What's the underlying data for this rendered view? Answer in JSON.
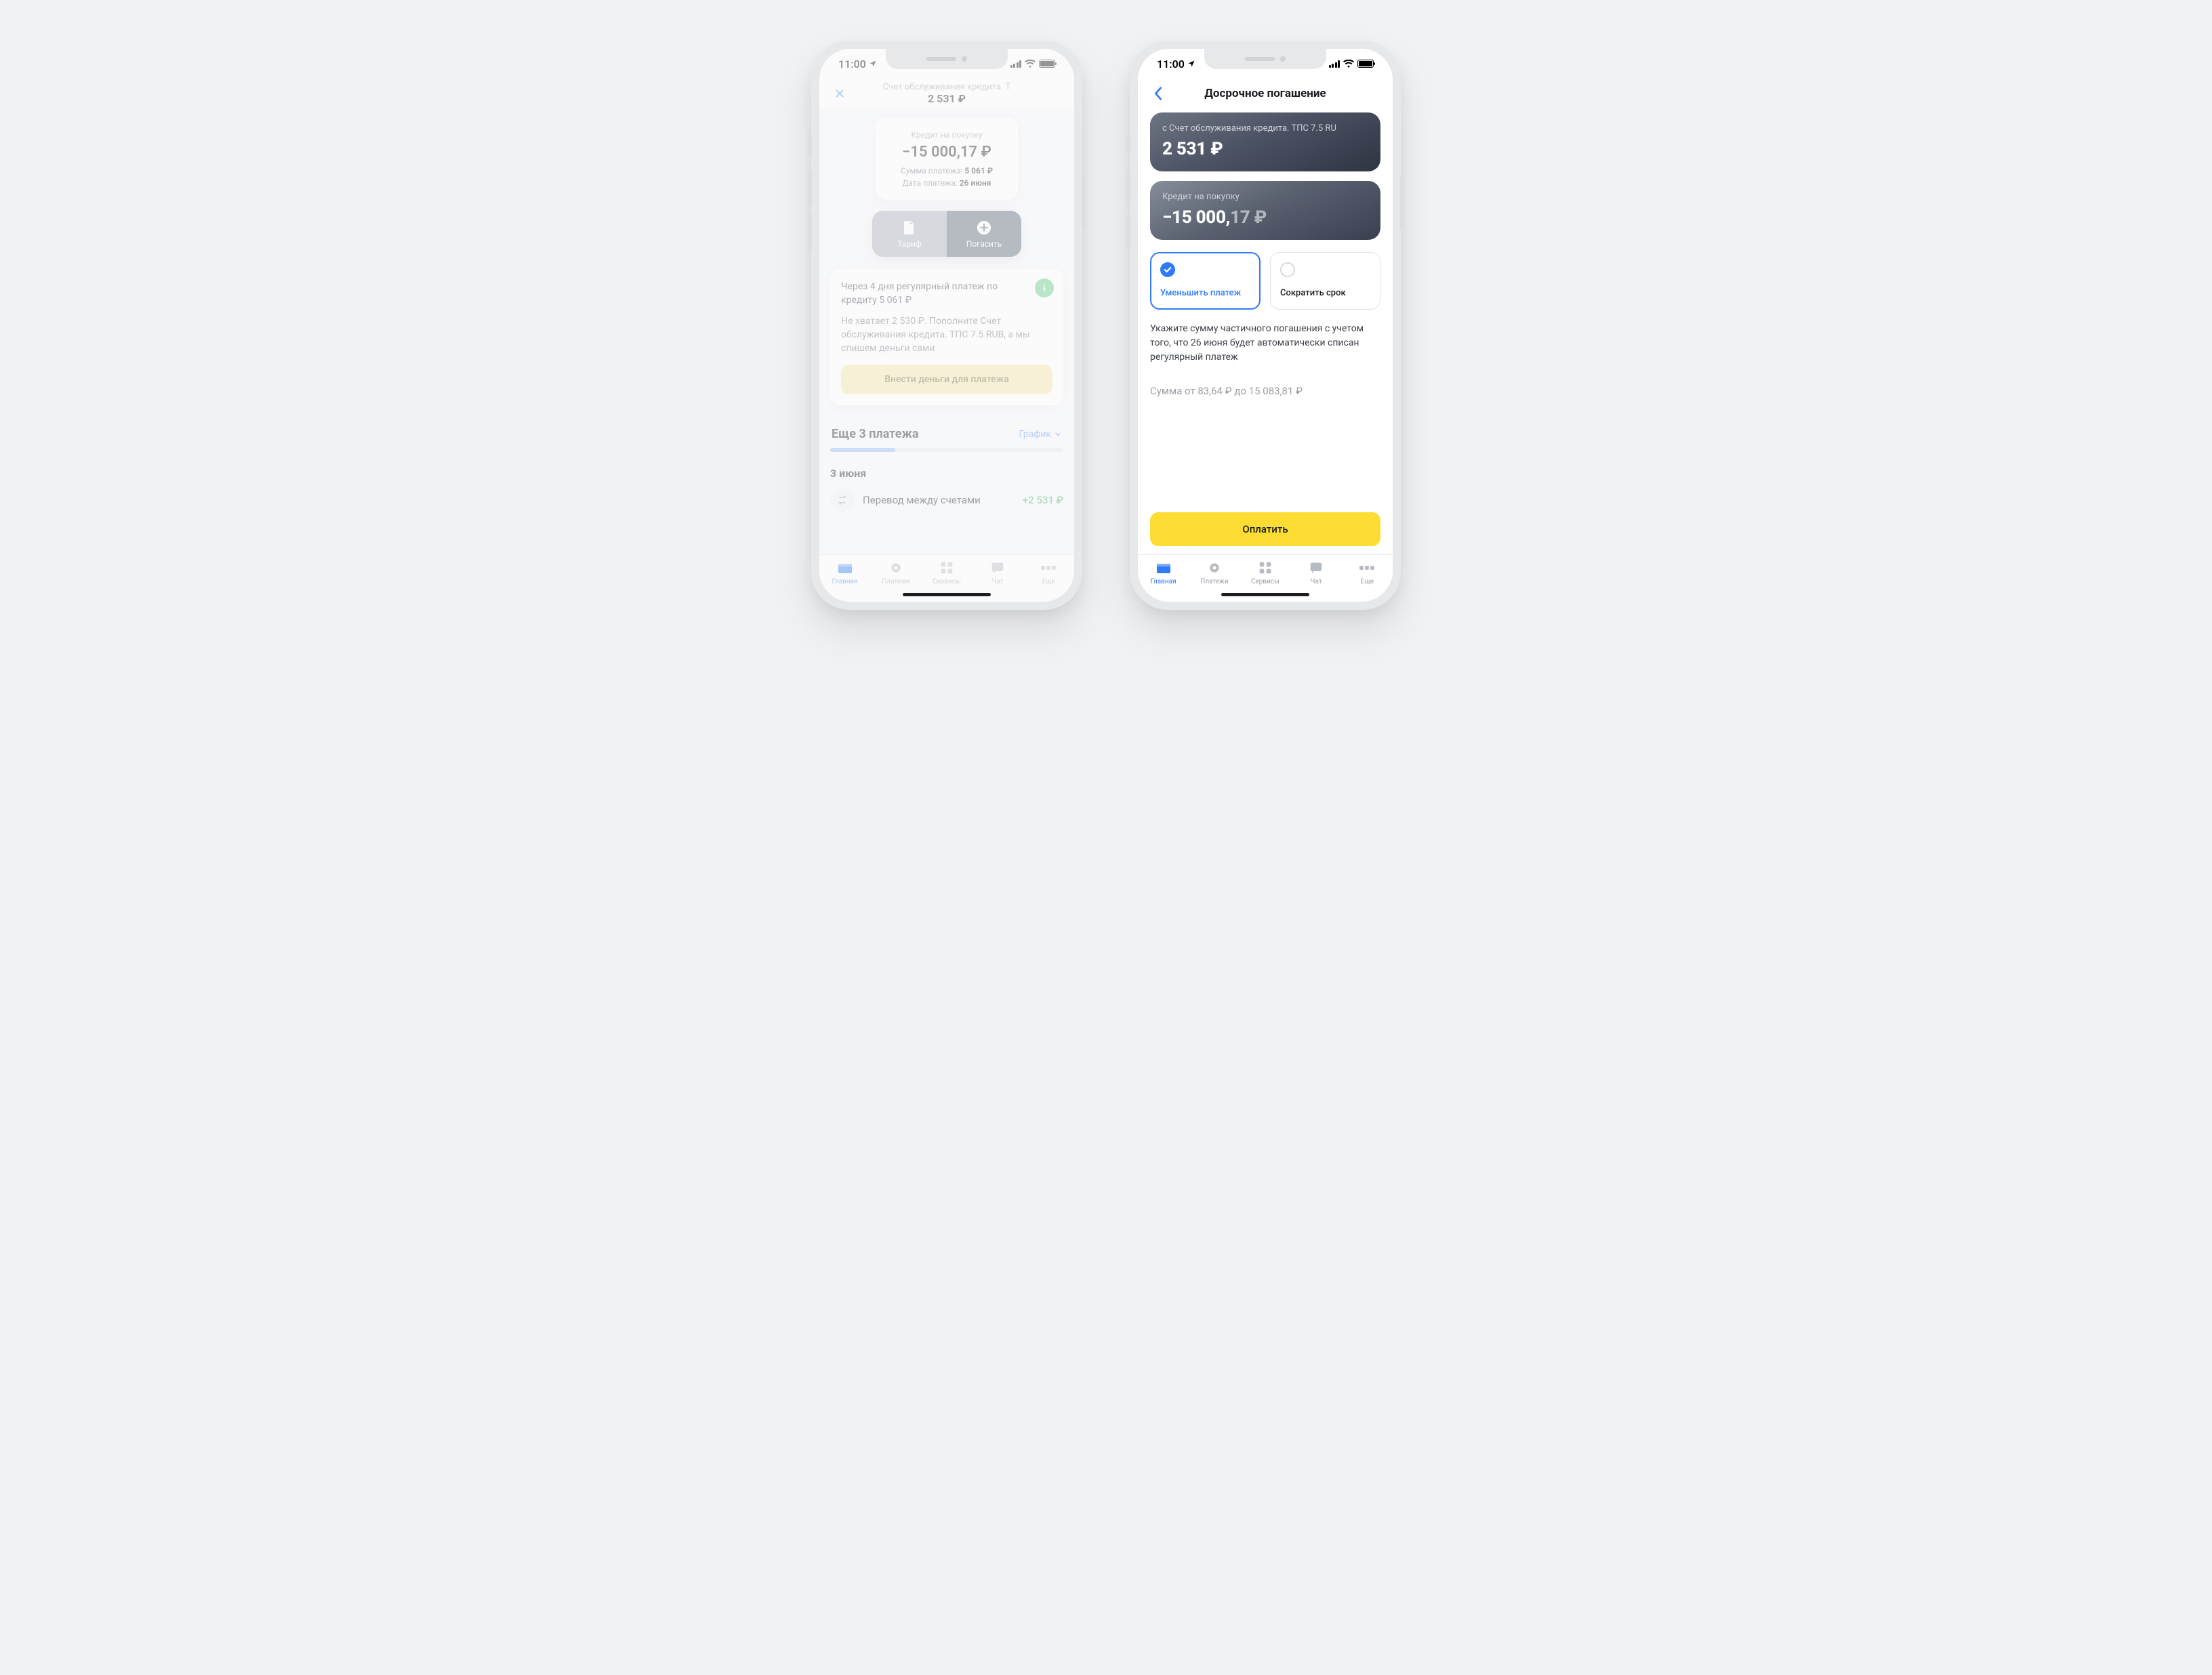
{
  "status": {
    "time": "11:00"
  },
  "left": {
    "header_sub": "Счет обслуживания кредита. Т",
    "header_amount": "2 531 ₽",
    "balance_card": {
      "label": "Кредит на покупку",
      "amount": "−15 000,17 ₽",
      "sum_label": "Сумма платежа:",
      "sum_value": "5 061 ₽",
      "date_label": "Дата платежа:",
      "date_value": "26 июня"
    },
    "seg": {
      "tariff": "Тариф",
      "pay": "Погасить"
    },
    "notice": {
      "line1": "Через 4 дня регулярный платеж по кредиту 5 061 ₽",
      "line2": "Не хватает 2 530 ₽. Пополните Счет обслуживания кредита. ТПС 7.5 RUB, а мы спишем деньги сами",
      "cta": "Внести деньги для платежа"
    },
    "more": {
      "title": "Еще 3 платежа",
      "link": "График"
    },
    "date_header": "3 июня",
    "txn": {
      "name": "Перевод между счетами",
      "amount": "+2 531 ₽"
    }
  },
  "right": {
    "title": "Досрочное погашение",
    "card_from": {
      "label": "с Счет обслуживания кредита. ТПС 7.5 RU",
      "amount": "2 531 ₽"
    },
    "card_to": {
      "label": "Кредит на покупку",
      "amount_int": "−15 000,",
      "amount_frac": "17 ₽"
    },
    "opt1": "Уменьшить платеж",
    "opt2": "Сократить срок",
    "hint": "Укажите сумму частичного погашения с учетом того, что 26 июня будет автоматически списан регулярный платеж",
    "amount_ph": "Сумма от 83,64 ₽ до 15 083,81 ₽",
    "pay": "Оплатить"
  },
  "tabs": {
    "home": "Главная",
    "pay": "Платежи",
    "svc": "Сервисы",
    "chat": "Чат",
    "more": "Еще"
  }
}
